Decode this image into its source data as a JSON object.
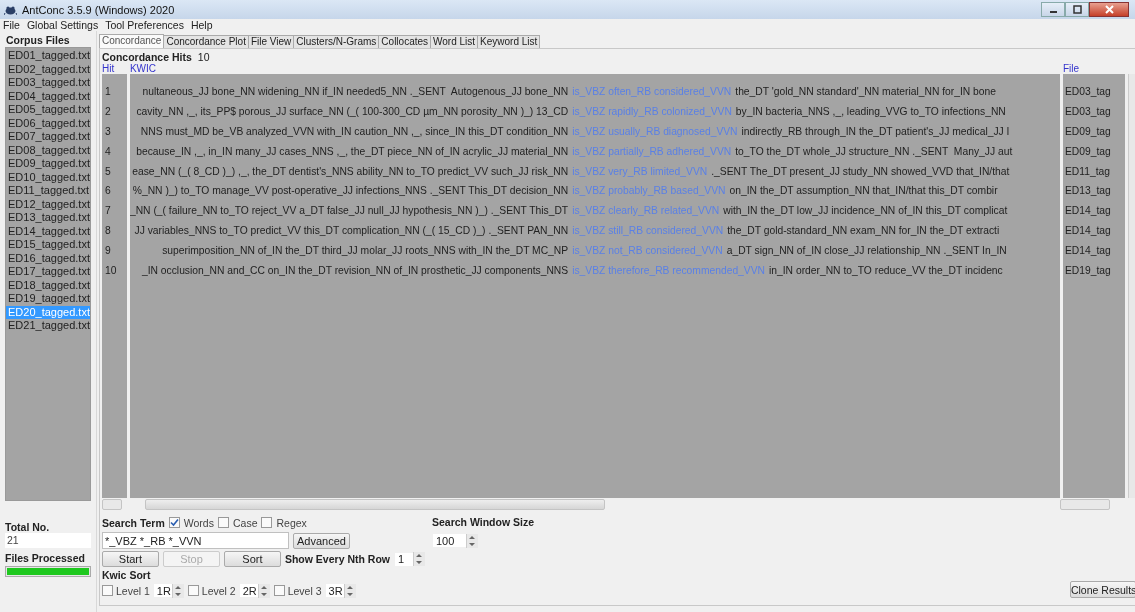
{
  "window": {
    "title": "AntConc 3.5.9 (Windows) 2020"
  },
  "menu": [
    "File",
    "Global Settings",
    "Tool Preferences",
    "Help"
  ],
  "corpus_files": {
    "title": "Corpus Files",
    "files": [
      {
        "name": "ED01_tagged.txt",
        "selected": false
      },
      {
        "name": "ED02_tagged.txt",
        "selected": false
      },
      {
        "name": "ED03_tagged.txt",
        "selected": false
      },
      {
        "name": "ED04_tagged.txt",
        "selected": false
      },
      {
        "name": "ED05_tagged.txt",
        "selected": false
      },
      {
        "name": "ED06_tagged.txt",
        "selected": false
      },
      {
        "name": "ED07_tagged.txt",
        "selected": false
      },
      {
        "name": "ED08_tagged.txt",
        "selected": false
      },
      {
        "name": "ED09_tagged.txt",
        "selected": false
      },
      {
        "name": "ED10_tagged.txt",
        "selected": false
      },
      {
        "name": "ED11_tagged.txt",
        "selected": false
      },
      {
        "name": "ED12_tagged.txt",
        "selected": false
      },
      {
        "name": "ED13_tagged.txt",
        "selected": false
      },
      {
        "name": "ED14_tagged.txt",
        "selected": false
      },
      {
        "name": "ED15_tagged.txt",
        "selected": false
      },
      {
        "name": "ED16_tagged.txt",
        "selected": false
      },
      {
        "name": "ED17_tagged.txt",
        "selected": false
      },
      {
        "name": "ED18_tagged.txt",
        "selected": false
      },
      {
        "name": "ED19_tagged.txt",
        "selected": false
      },
      {
        "name": "ED20_tagged.txt",
        "selected": true
      },
      {
        "name": "ED21_tagged.txt",
        "selected": false
      }
    ],
    "total_label": "Total No.",
    "total": "21",
    "processed_label": "Files Processed",
    "progress": {
      "level": 1
    }
  },
  "tabs": [
    {
      "label": "Concordance",
      "selected": true
    },
    {
      "label": "Concordance Plot",
      "selected": false
    },
    {
      "label": "File View",
      "selected": false
    },
    {
      "label": "Clusters/N-Grams",
      "selected": false
    },
    {
      "label": "Collocates",
      "selected": false
    },
    {
      "label": "Word List",
      "selected": false
    },
    {
      "label": "Keyword List",
      "selected": false
    }
  ],
  "hits": {
    "label": "Concordance Hits",
    "count": "10"
  },
  "table": {
    "columns": [
      "Hit",
      "KWIC",
      "File"
    ],
    "rows": [
      {
        "hit": "1",
        "left": "nultaneous_JJ bone_NN widening_NN if_IN needed5_NN ._SENT  Autogenous_JJ bone_NN",
        "keyword": "is_VBZ often_RB considered_VVN",
        "right": "the_DT 'gold_NN standard'_NN material_NN for_IN bone",
        "file": "ED03_tag"
      },
      {
        "hit": "2",
        "left": "cavity_NN ,_, its_PP$ porous_JJ surface_NN (_( 100-300_CD µm_NN porosity_NN )_) 13_CD",
        "keyword": "is_VBZ rapidly_RB colonized_VVN",
        "right": "by_IN bacteria_NNS ,_, leading_VVG to_TO infections_NN",
        "file": "ED03_tag"
      },
      {
        "hit": "3",
        "left": "NNS must_MD be_VB analyzed_VVN with_IN caution_NN ,_, since_IN this_DT condition_NN",
        "keyword": "is_VBZ usually_RB diagnosed_VVN",
        "right": "indirectly_RB through_IN the_DT patient's_JJ medical_JJ I",
        "file": "ED09_tag"
      },
      {
        "hit": "4",
        "left": "because_IN ,_, in_IN many_JJ cases_NNS ,_, the_DT piece_NN of_IN acrylic_JJ material_NN",
        "keyword": "is_VBZ partially_RB adhered_VVN",
        "right": "to_TO the_DT whole_JJ structure_NN ._SENT  Many_JJ aut",
        "file": "ED09_tag"
      },
      {
        "hit": "5",
        "left": "ease_NN (_( 8_CD )_) ,_, the_DT dentist's_NNS ability_NN to_TO predict_VV such_JJ risk_NN",
        "keyword": "is_VBZ very_RB limited_VVN",
        "right": "._SENT The_DT present_JJ study_NN showed_VVD that_IN/that",
        "file": "ED11_tag"
      },
      {
        "hit": "6",
        "left": "%_NN )_) to_TO manage_VV post-operative_JJ infections_NNS ._SENT This_DT decision_NN",
        "keyword": "is_VBZ probably_RB based_VVN",
        "right": "on_IN the_DT assumption_NN that_IN/that this_DT combir",
        "file": "ED13_tag"
      },
      {
        "hit": "7",
        "left": "_NN (_( failure_NN to_TO reject_VV a_DT false_JJ null_JJ hypothesis_NN )_) ._SENT This_DT",
        "keyword": "is_VBZ clearly_RB related_VVN",
        "right": "with_IN the_DT low_JJ incidence_NN of_IN this_DT complicat",
        "file": "ED14_tag"
      },
      {
        "hit": "8",
        "left": "JJ variables_NNS to_TO predict_VV this_DT complication_NN (_( 15_CD )_) ._SENT PAN_NN",
        "keyword": "is_VBZ still_RB considered_VVN",
        "right": "the_DT gold-standard_NN exam_NN for_IN the_DT extracti",
        "file": "ED14_tag"
      },
      {
        "hit": "9",
        "left": "superimposition_NN of_IN the_DT third_JJ molar_JJ roots_NNS with_IN the_DT MC_NP",
        "keyword": "is_VBZ not_RB considered_VVN",
        "right": "a_DT sign_NN of_IN close_JJ relationship_NN ._SENT In_IN",
        "file": "ED14_tag"
      },
      {
        "hit": "10",
        "left": "_IN occlusion_NN and_CC on_IN the_DT revision_NN of_IN prosthetic_JJ components_NNS",
        "keyword": "is_VBZ therefore_RB recommended_VVN",
        "right": "in_IN order_NN to_TO reduce_VV the_DT incidenc",
        "file": "ED19_tag"
      }
    ]
  },
  "search": {
    "label": "Search Term",
    "options": [
      {
        "label": "Words",
        "checked": true
      },
      {
        "label": "Case",
        "checked": false
      },
      {
        "label": "Regex",
        "checked": false
      }
    ],
    "value": "*_VBZ *_RB *_VVN",
    "advanced": "Advanced",
    "buttons": [
      {
        "label": "Start",
        "disabled": false
      },
      {
        "label": "Stop",
        "disabled": true
      },
      {
        "label": "Sort",
        "disabled": false
      }
    ],
    "nth_label": "Show Every Nth Row",
    "nth": "1",
    "window_label": "Search Window Size",
    "window_size": "100"
  },
  "kwic_sort": {
    "label": "Kwic Sort",
    "levels": [
      {
        "label": "Level 1",
        "value": "1R",
        "checked": false
      },
      {
        "label": "Level 2",
        "value": "2R",
        "checked": false
      },
      {
        "label": "Level 3",
        "value": "3R",
        "checked": false
      }
    ]
  },
  "clone_button": "Clone Results"
}
